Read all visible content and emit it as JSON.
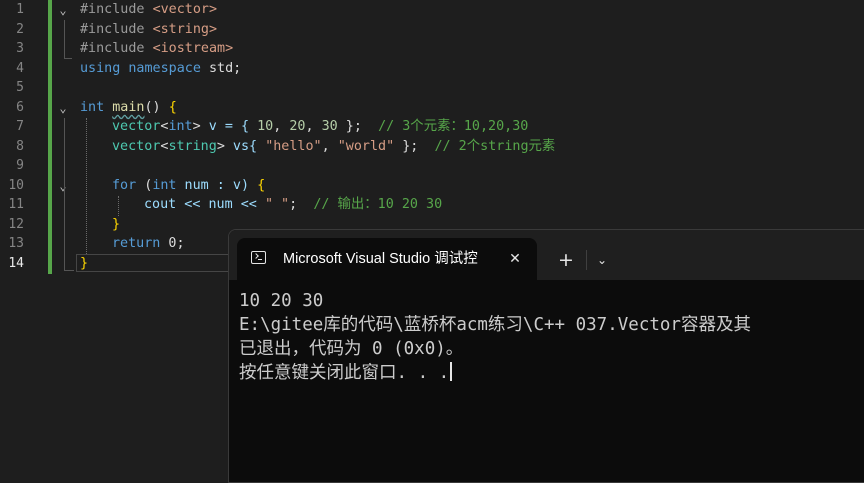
{
  "editor": {
    "line_numbers": [
      "1",
      "2",
      "3",
      "4",
      "5",
      "6",
      "7",
      "8",
      "9",
      "10",
      "11",
      "12",
      "13",
      "14"
    ],
    "active_line": "14",
    "code": {
      "l1_kw": "#include",
      "l1_hdr": "<vector>",
      "l2_kw": "#include",
      "l2_hdr": "<string>",
      "l3_kw": "#include",
      "l3_hdr": "<iostream>",
      "l4_using": "using",
      "l4_ns": "namespace",
      "l4_std": "std;",
      "l6_int": "int",
      "l6_main": "main",
      "l6_parens": "() ",
      "l6_brace": "{",
      "l7_vector": "vector",
      "l7_lt": "<",
      "l7_int": "int",
      "l7_gt": ">",
      "l7_v": " v = { ",
      "l7_n1": "10",
      "l7_sep1": ", ",
      "l7_n2": "20",
      "l7_sep2": ", ",
      "l7_n3": "30",
      "l7_end": " };  ",
      "l7_comment": "// 3个元素：10,20,30",
      "l8_vector": "vector",
      "l8_lt": "<",
      "l8_string": "string",
      "l8_gt": ">",
      "l8_vs": " vs{ ",
      "l8_s1": "\"hello\"",
      "l8_sep": ", ",
      "l8_s2": "\"world\"",
      "l8_end": " };  ",
      "l8_comment": "// 2个string元素",
      "l10_for": "for",
      "l10_open": " (",
      "l10_int": "int",
      "l10_num": " num : v) ",
      "l10_brace": "{",
      "l11_cout": "cout << num << ",
      "l11_str": "\" \"",
      "l11_semi": ";  ",
      "l11_comment": "// 输出：10 20 30",
      "l12_brace": "}",
      "l13_return": "return",
      "l13_zero": " 0;",
      "l14_brace": "}"
    }
  },
  "console": {
    "tab_title": "Microsoft Visual Studio 调试控",
    "tab_icon": "terminal-icon",
    "close_symbol": "✕",
    "new_tab_symbol": "+",
    "dropdown_symbol": "⌄",
    "output": [
      "10 20 30",
      "E:\\gitee库的代码\\蓝桥杯acm练习\\C++ 037.Vector容器及其",
      "已退出，代码为 0 (0x0)。",
      "按任意键关闭此窗口. . ."
    ]
  }
}
